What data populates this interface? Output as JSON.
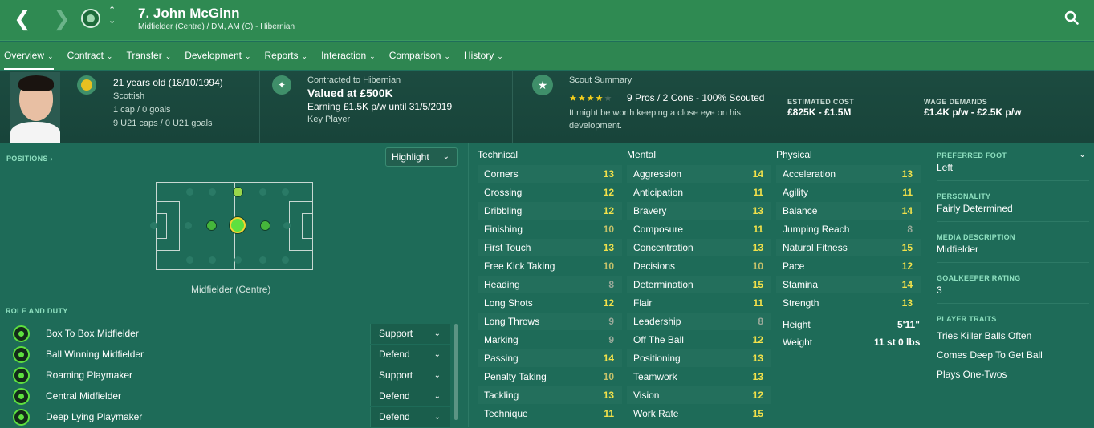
{
  "header": {
    "player_name": "7. John McGinn",
    "player_sub": "Midfielder (Centre) / DM, AM (C) - Hibernian",
    "back_glyph": "❮",
    "forward_glyph": "❯"
  },
  "tabs": [
    {
      "label": "Overview"
    },
    {
      "label": "Contract"
    },
    {
      "label": "Transfer"
    },
    {
      "label": "Development"
    },
    {
      "label": "Reports"
    },
    {
      "label": "Interaction"
    },
    {
      "label": "Comparison"
    },
    {
      "label": "History"
    }
  ],
  "info": {
    "age": "21 years old (18/10/1994)",
    "nationality": "Scottish",
    "caps": "1 cap / 0 goals",
    "u21_caps": "9 U21 caps / 0 U21 goals",
    "contract_label": "Contracted to Hibernian",
    "value": "Valued at £500K",
    "earning": "Earning £1.5K p/w until 31/5/2019",
    "squad_status": "Key Player",
    "scout_label": "Scout Summary",
    "scout_rating_stars": 4,
    "scout_rating_max": 5,
    "scout_pros": "9 Pros / 2 Cons - 100% Scouted",
    "scout_note": "It might be worth keeping a close eye on his development.",
    "estimated_cost_label": "ESTIMATED COST",
    "estimated_cost": "£825K - £1.5M",
    "wage_label": "WAGE DEMANDS",
    "wage": "£1.4K p/w - £2.5K p/w"
  },
  "positions": {
    "label": "POSITIONS ›",
    "highlight_label": "Highlight",
    "caption": "Midfielder (Centre)"
  },
  "roles": {
    "label": "ROLE AND DUTY",
    "items": [
      {
        "name": "Box To Box Midfielder",
        "duty": "Support"
      },
      {
        "name": "Ball Winning Midfielder",
        "duty": "Defend"
      },
      {
        "name": "Roaming Playmaker",
        "duty": "Support"
      },
      {
        "name": "Central Midfielder",
        "duty": "Defend"
      },
      {
        "name": "Deep Lying Playmaker",
        "duty": "Defend"
      }
    ]
  },
  "attributes": {
    "technical_label": "Technical",
    "mental_label": "Mental",
    "physical_label": "Physical",
    "technical": [
      {
        "name": "Corners",
        "value": "13"
      },
      {
        "name": "Crossing",
        "value": "12"
      },
      {
        "name": "Dribbling",
        "value": "12"
      },
      {
        "name": "Finishing",
        "value": "10"
      },
      {
        "name": "First Touch",
        "value": "13"
      },
      {
        "name": "Free Kick Taking",
        "value": "10"
      },
      {
        "name": "Heading",
        "value": "8"
      },
      {
        "name": "Long Shots",
        "value": "12"
      },
      {
        "name": "Long Throws",
        "value": "9"
      },
      {
        "name": "Marking",
        "value": "9"
      },
      {
        "name": "Passing",
        "value": "14"
      },
      {
        "name": "Penalty Taking",
        "value": "10"
      },
      {
        "name": "Tackling",
        "value": "13"
      },
      {
        "name": "Technique",
        "value": "11"
      }
    ],
    "mental": [
      {
        "name": "Aggression",
        "value": "14"
      },
      {
        "name": "Anticipation",
        "value": "11"
      },
      {
        "name": "Bravery",
        "value": "13"
      },
      {
        "name": "Composure",
        "value": "11"
      },
      {
        "name": "Concentration",
        "value": "13"
      },
      {
        "name": "Decisions",
        "value": "10"
      },
      {
        "name": "Determination",
        "value": "15"
      },
      {
        "name": "Flair",
        "value": "11"
      },
      {
        "name": "Leadership",
        "value": "8"
      },
      {
        "name": "Off The Ball",
        "value": "12"
      },
      {
        "name": "Positioning",
        "value": "13"
      },
      {
        "name": "Teamwork",
        "value": "13"
      },
      {
        "name": "Vision",
        "value": "12"
      },
      {
        "name": "Work Rate",
        "value": "15"
      }
    ],
    "physical": [
      {
        "name": "Acceleration",
        "value": "13"
      },
      {
        "name": "Agility",
        "value": "11"
      },
      {
        "name": "Balance",
        "value": "14"
      },
      {
        "name": "Jumping Reach",
        "value": "8"
      },
      {
        "name": "Natural Fitness",
        "value": "15"
      },
      {
        "name": "Pace",
        "value": "12"
      },
      {
        "name": "Stamina",
        "value": "14"
      },
      {
        "name": "Strength",
        "value": "13"
      }
    ],
    "height_label": "Height",
    "height": "5'11\"",
    "weight_label": "Weight",
    "weight": "11 st 0 lbs"
  },
  "side": {
    "preferred_foot_label": "PREFERRED FOOT",
    "preferred_foot": "Left",
    "personality_label": "PERSONALITY",
    "personality": "Fairly Determined",
    "media_label": "MEDIA DESCRIPTION",
    "media": "Midfielder",
    "gk_label": "GOALKEEPER RATING",
    "gk": "3",
    "traits_label": "PLAYER TRAITS",
    "traits": [
      "Tries Killer Balls Often",
      "Comes Deep To Get Ball",
      "Plays One-Twos"
    ]
  }
}
